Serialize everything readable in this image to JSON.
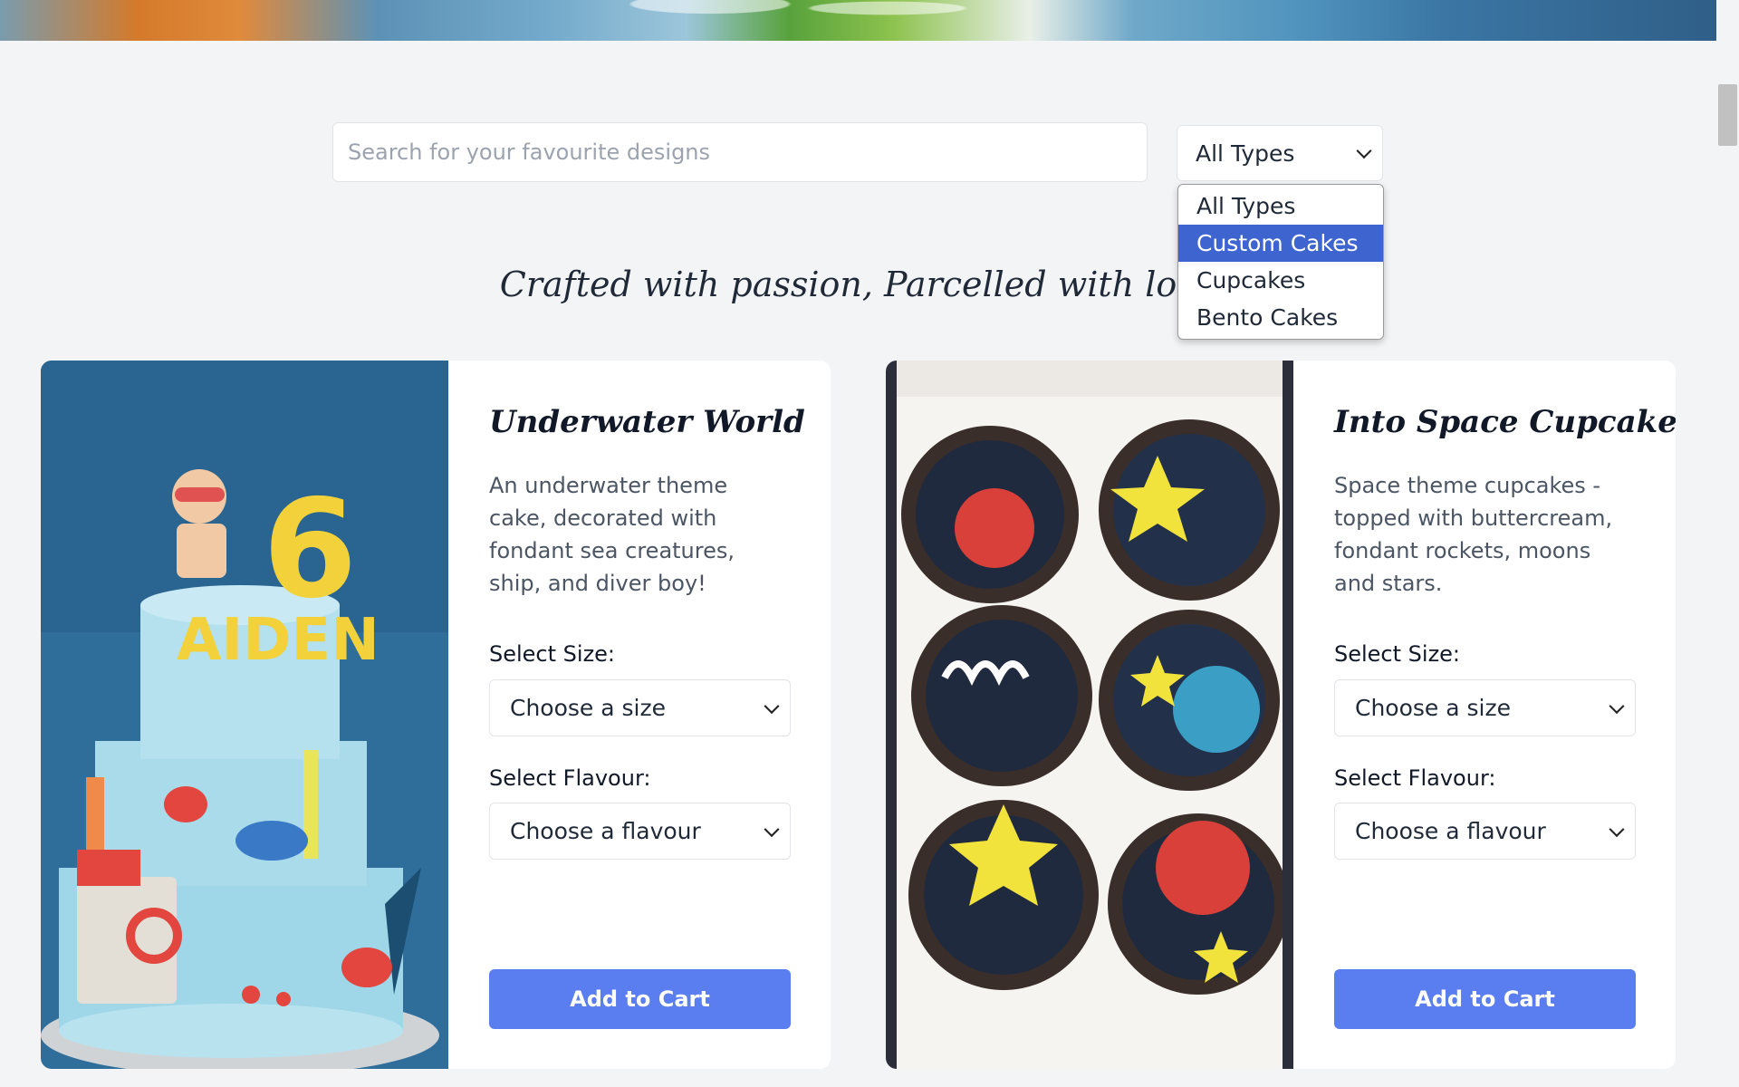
{
  "search": {
    "placeholder": "Search for your favourite designs"
  },
  "type_filter": {
    "selected": "All Types",
    "options": [
      "All Types",
      "Custom Cakes",
      "Cupcakes",
      "Bento Cakes"
    ],
    "highlighted": "Custom Cakes"
  },
  "tagline": "Crafted with passion, Parcelled with love",
  "products": [
    {
      "title": "Underwater World",
      "description": "An underwater theme cake, decorated with fondant sea creatures, ship, and diver boy!",
      "size_label": "Select Size:",
      "size_placeholder": "Choose a size",
      "flavour_label": "Select Flavour:",
      "flavour_placeholder": "Choose a flavour",
      "button": "Add to Cart"
    },
    {
      "title": "Into Space Cupcakes",
      "description": "Space theme cupcakes - topped with buttercream, fondant rockets, moons and stars.",
      "size_label": "Select Size:",
      "size_placeholder": "Choose a size",
      "flavour_label": "Select Flavour:",
      "flavour_placeholder": "Choose a flavour",
      "button": "Add to Cart"
    }
  ],
  "colors": {
    "accent": "#5a7df0",
    "highlight": "#3d64cf",
    "background": "#f3f4f6"
  }
}
